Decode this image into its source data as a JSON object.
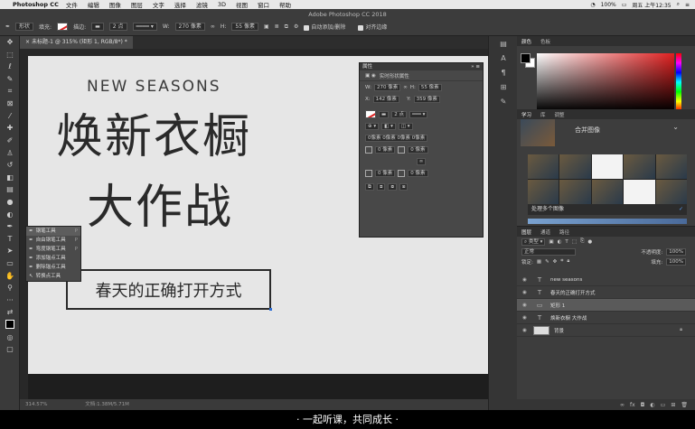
{
  "menubar": {
    "app": "Photoshop CC",
    "items": [
      "文件",
      "编辑",
      "图像",
      "图层",
      "文字",
      "选择",
      "滤镜",
      "3D",
      "视图",
      "窗口",
      "帮助"
    ],
    "battery": "100%",
    "datetime": "周五 上午12:35"
  },
  "options": {
    "window_title": "Adobe Photoshop CC 2018",
    "mode": "形状",
    "fill_label": "填充:",
    "stroke_label": "描边:",
    "stroke_width": "2 点",
    "w_label": "W:",
    "w_value": "270 像素",
    "h_label": "H:",
    "h_value": "55 像素",
    "auto_add_delete": "自动添加/删除",
    "align_edges": "对齐边缘"
  },
  "doc": {
    "tab": "未标题-1 @ 315% (矩形 1, RGB/8*) *",
    "zoom_status": "314.57%",
    "doc_status": "文档:1.38M/5.71M"
  },
  "canvas": {
    "new_seasons": "NEW SEASONS",
    "headline1": "焕新衣橱",
    "headline2": "大作战",
    "boxed_text": "春天的正确打开方式"
  },
  "flyout": {
    "items": [
      {
        "label": "钢笔工具",
        "key": "P"
      },
      {
        "label": "自由钢笔工具",
        "key": "P"
      },
      {
        "label": "弯度钢笔工具",
        "key": "P"
      },
      {
        "label": "添加锚点工具",
        "key": ""
      },
      {
        "label": "删除锚点工具",
        "key": ""
      },
      {
        "label": "转换点工具",
        "key": ""
      }
    ]
  },
  "properties": {
    "title": "属性",
    "subtitle": "实时形状属性",
    "w": "270 像素",
    "h": "55 像素",
    "x": "142 像素",
    "y": "359 像素",
    "stroke_width": "2 点",
    "radius_row": "0像素 0像素 0像素 0像素",
    "c1": "0 像素",
    "c2": "0 像素",
    "c3": "0 像素",
    "c4": "0 像素"
  },
  "right_panels": {
    "color_tabs": [
      "颜色",
      "色板"
    ],
    "learn_tabs": [
      "学习",
      "库",
      "调整"
    ],
    "learn_item": "合并图像",
    "learn_caption": "处理多个图像",
    "layer_tabs": [
      "图层",
      "通道",
      "路径"
    ],
    "kind": "类型",
    "blend": "正常",
    "opacity_label": "不透明度:",
    "opacity": "100%",
    "lock_label": "锁定:",
    "fill_label": "填充:",
    "fill": "100%",
    "layers": [
      {
        "name": "new seasons",
        "type": "T"
      },
      {
        "name": "春天的正确打开方式",
        "type": "T"
      },
      {
        "name": "矩形 1",
        "type": "shape"
      },
      {
        "name": "焕新衣橱 大作战",
        "type": "T"
      },
      {
        "name": "背景",
        "type": "bg"
      }
    ]
  },
  "subtitle": "· 一起听课，共同成长 ·"
}
